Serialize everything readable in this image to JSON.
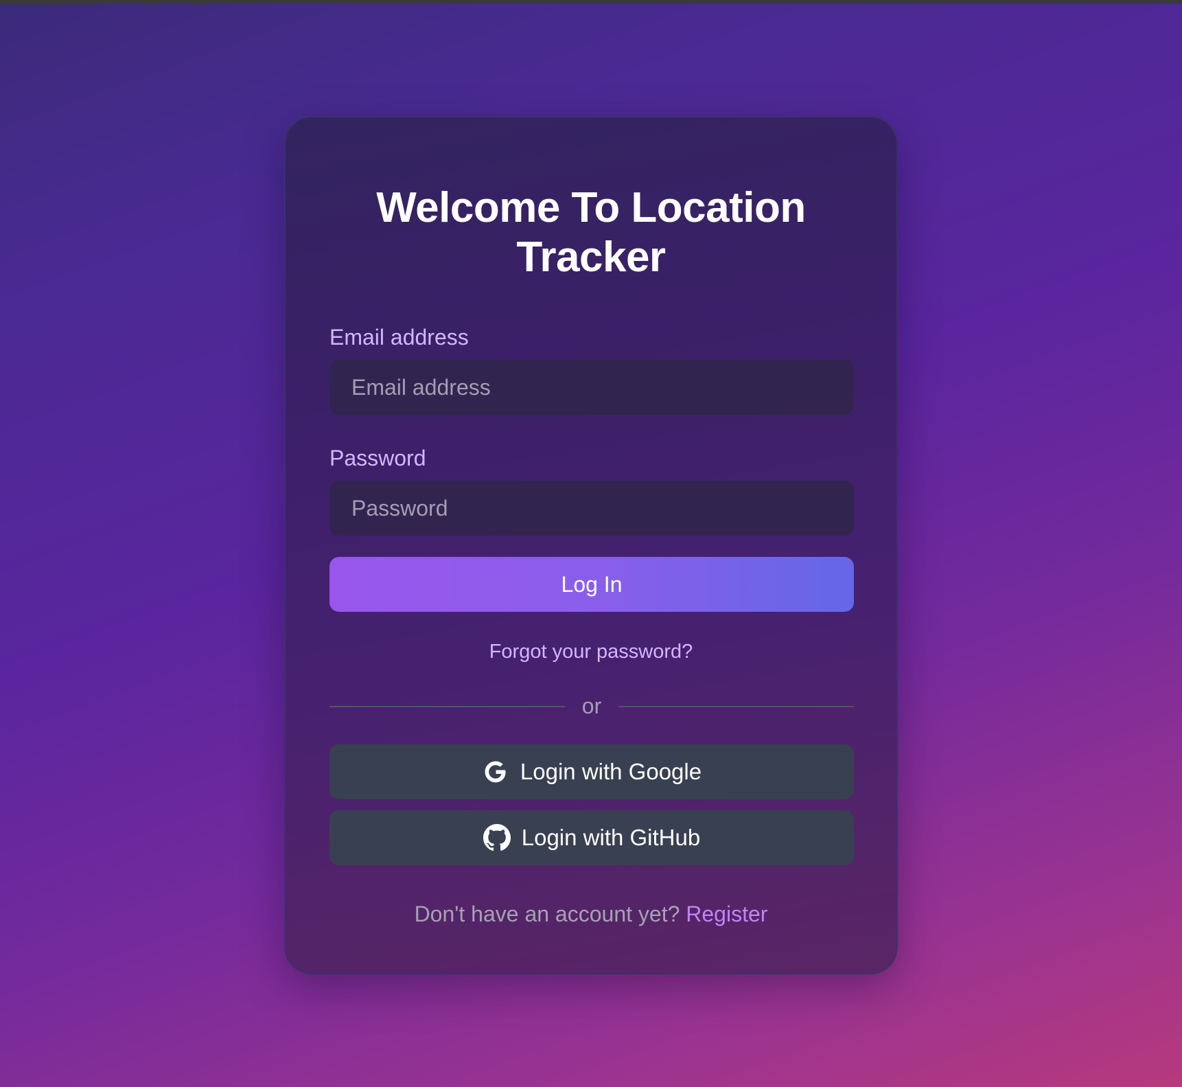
{
  "page": {
    "title": "Welcome To Location Tracker"
  },
  "form": {
    "email_label": "Email address",
    "email_placeholder": "Email address",
    "email_value": "",
    "password_label": "Password",
    "password_placeholder": "Password",
    "password_value": "",
    "login_button": "Log In",
    "forgot_link": "Forgot your password?",
    "divider_text": "or"
  },
  "oauth": {
    "google_label": "Login with Google",
    "google_icon": "google-icon",
    "github_label": "Login with GitHub",
    "github_icon": "github-icon"
  },
  "footer": {
    "prompt": "Don't have an account yet?",
    "register_link": "Register"
  },
  "colors": {
    "accent_gradient_start": "#9a56ec",
    "accent_gradient_end": "#6467e8",
    "label_color": "#d4b6ff",
    "link_color": "#c084f5",
    "oauth_button_bg": "#394051"
  }
}
